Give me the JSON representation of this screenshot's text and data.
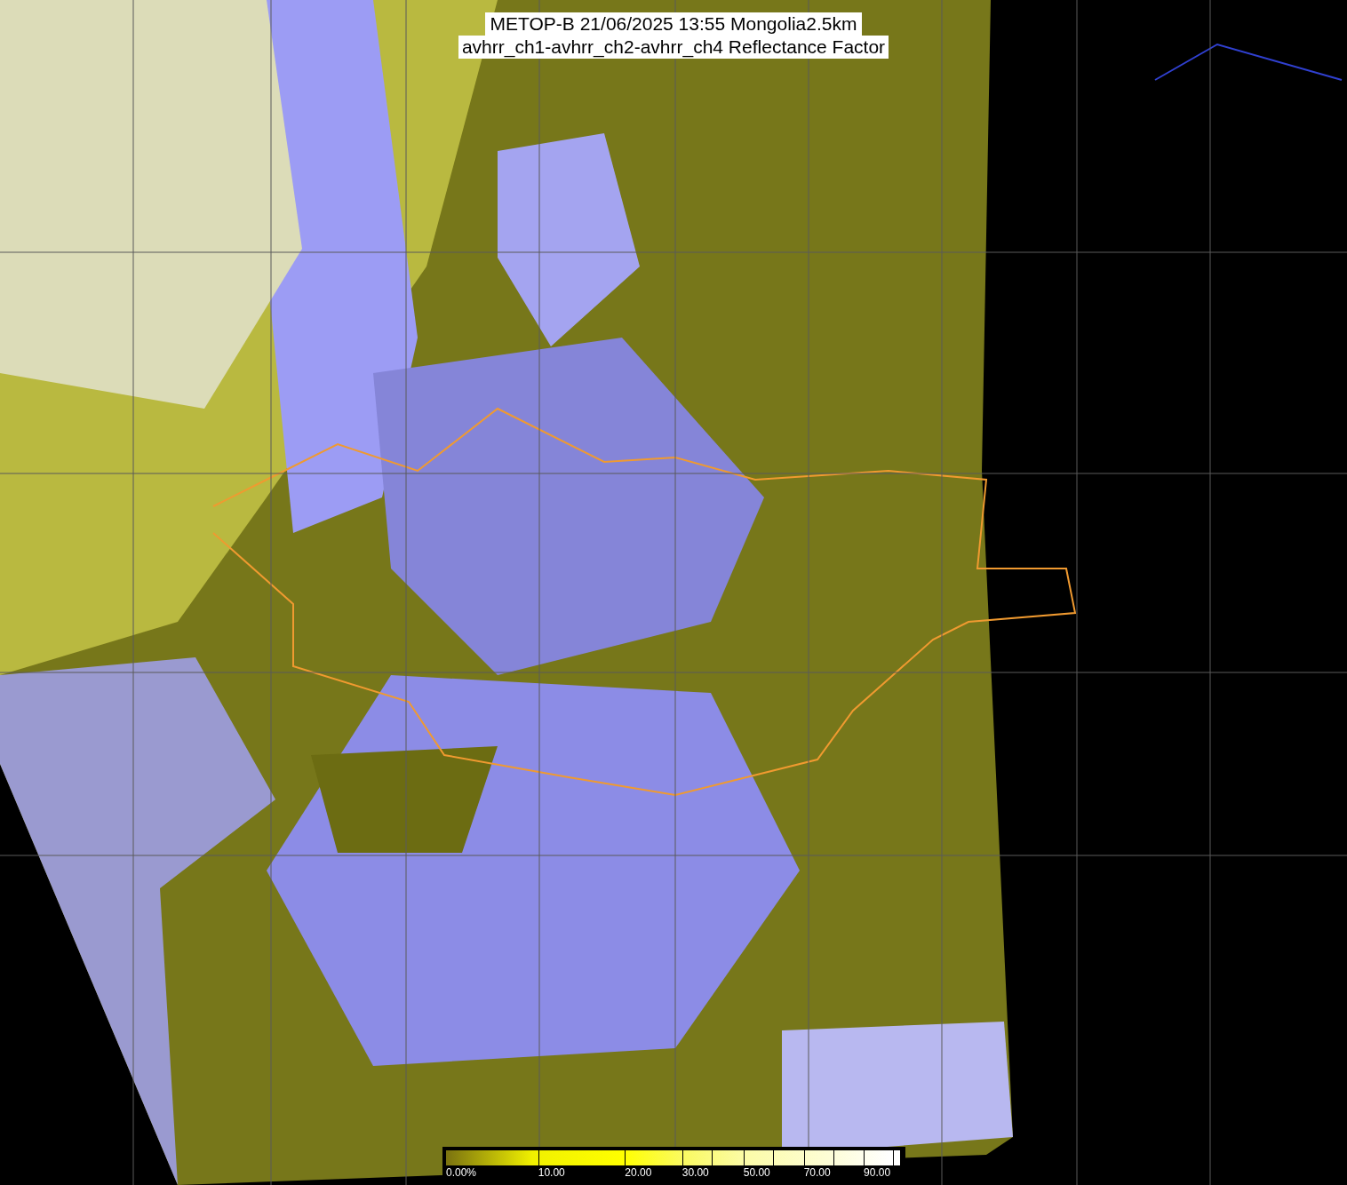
{
  "title": {
    "line_1": "METOP-B 21/06/2025 13:55 Mongolia2.5km",
    "line_2": "avhrr_ch1-avhrr_ch2-avhrr_ch4 Reflectance Factor"
  },
  "colorbar": {
    "labels": [
      "0.00%",
      "10.00",
      "20.00",
      "30.00",
      "50.00",
      "70.00",
      "90.00"
    ]
  }
}
